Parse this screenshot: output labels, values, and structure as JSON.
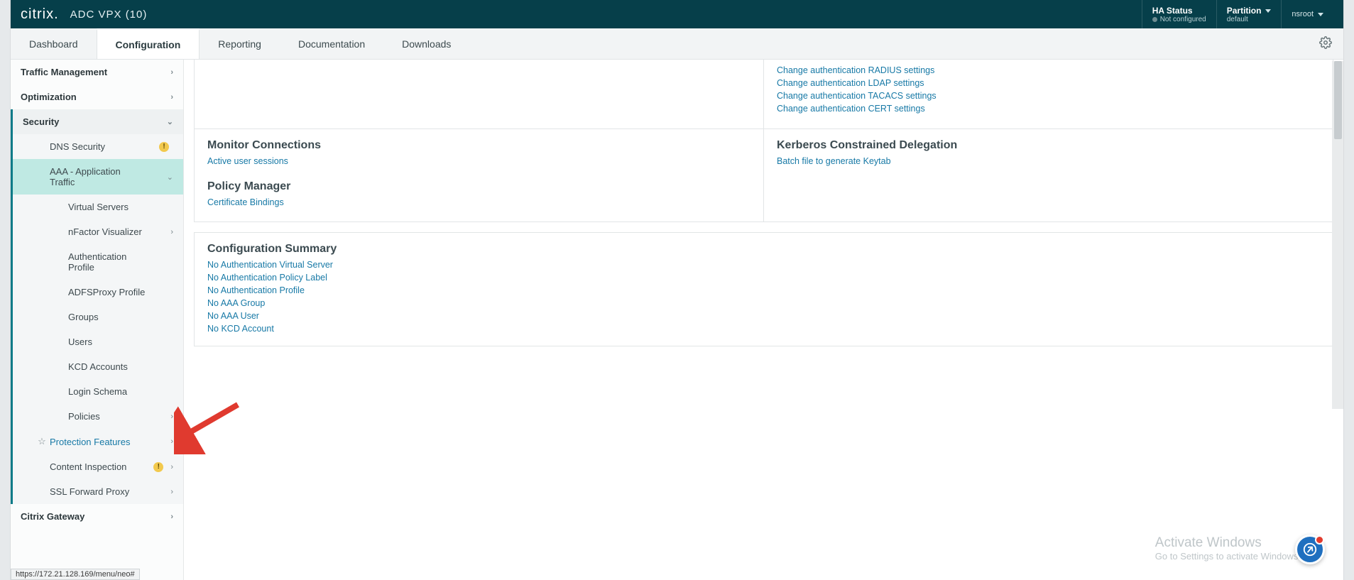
{
  "header": {
    "brand": "citrix.",
    "product": "ADC VPX (10)",
    "ha_title": "HA Status",
    "ha_value": "Not configured",
    "partition_title": "Partition",
    "partition_value": "default",
    "user": "nsroot"
  },
  "tabs": {
    "dashboard": "Dashboard",
    "configuration": "Configuration",
    "reporting": "Reporting",
    "documentation": "Documentation",
    "downloads": "Downloads"
  },
  "sidebar": {
    "traffic": "Traffic Management",
    "optimization": "Optimization",
    "security": "Security",
    "dns_security": "DNS Security",
    "aaa": "AAA - Application Traffic",
    "virtual_servers": "Virtual Servers",
    "nfactor": "nFactor Visualizer",
    "auth_profile": "Authentication Profile",
    "adfs": "ADFSProxy Profile",
    "groups": "Groups",
    "users": "Users",
    "kcd": "KCD Accounts",
    "login_schema": "Login Schema",
    "policies": "Policies",
    "protection": "Protection Features",
    "content_inspection": "Content Inspection",
    "ssl_forward": "SSL Forward Proxy",
    "citrix_gateway": "Citrix Gateway",
    "badge": "!"
  },
  "content": {
    "auth_links": {
      "radius": "Change authentication RADIUS settings",
      "ldap": "Change authentication LDAP settings",
      "tacacs": "Change authentication TACACS settings",
      "cert": "Change authentication CERT settings"
    },
    "monitor": {
      "title": "Monitor Connections",
      "link1": "Active user sessions"
    },
    "kerberos": {
      "title": "Kerberos Constrained Delegation",
      "link1": "Batch file to generate Keytab"
    },
    "policy_mgr": {
      "title": "Policy Manager",
      "link1": "Certificate Bindings"
    },
    "summary": {
      "title": "Configuration Summary",
      "no": "No",
      "items": {
        "a": "Authentication Virtual Server",
        "b": "Authentication Policy Label",
        "c": "Authentication Profile",
        "d": "AAA Group",
        "e": "AAA User",
        "f": "KCD Account"
      }
    }
  },
  "misc": {
    "activate_title": "Activate Windows",
    "activate_sub": "Go to Settings to activate Windows.",
    "status_url": "https://172.21.128.169/menu/neo#"
  }
}
